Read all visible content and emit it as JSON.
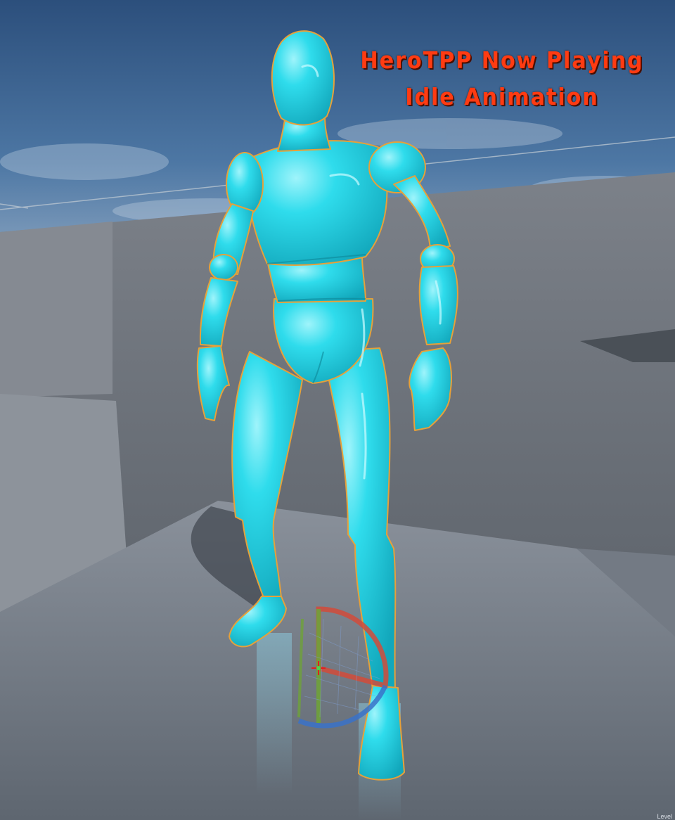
{
  "overlay": {
    "line1": "HeroTPP Now Playing",
    "line2": "Idle Animation"
  },
  "viewport": {
    "corner_label": "Level"
  },
  "colors": {
    "mannequin": "#26d6e8",
    "selection_outline": "#e6a13a",
    "overlay_text": "#ff3b12",
    "sky": "#3f6896",
    "walls": "#6e747c"
  },
  "icons": {
    "gizmo": "rotation-gizmo-icon"
  }
}
